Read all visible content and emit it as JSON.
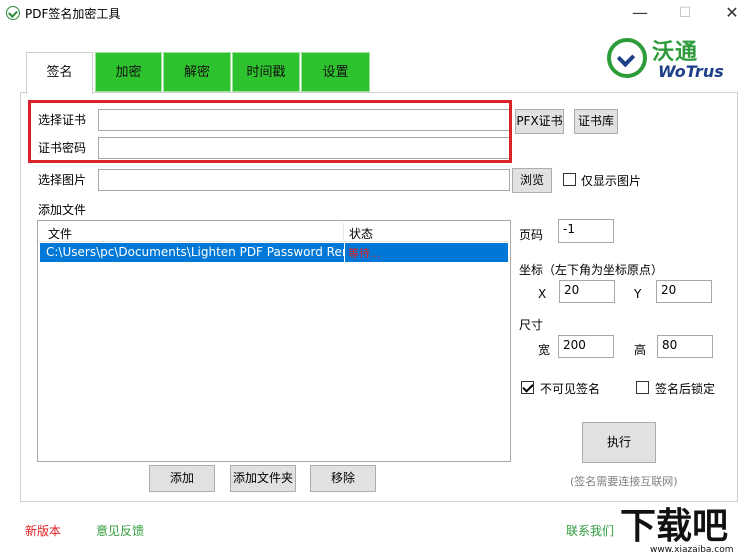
{
  "window": {
    "title": "PDF签名加密工具",
    "minimize": "—",
    "maximize": "☐",
    "close": "✕"
  },
  "logo": {
    "cn": "沃通",
    "en": "WoTrus"
  },
  "tabs": [
    {
      "label": "签名",
      "active": true
    },
    {
      "label": "加密",
      "active": false
    },
    {
      "label": "解密",
      "active": false
    },
    {
      "label": "时间戳",
      "active": false
    },
    {
      "label": "设置",
      "active": false
    }
  ],
  "form": {
    "cert_label": "选择证书",
    "cert_value": "",
    "password_label": "证书密码",
    "password_value": "",
    "pfx_button": "PFX证书",
    "certstore_button": "证书库",
    "image_label": "选择图片",
    "image_value": "",
    "browse_button": "浏览",
    "only_image_label": "仅显示图片",
    "only_image_checked": false
  },
  "files": {
    "section_label": "添加文件",
    "columns": [
      "文件",
      "状态"
    ],
    "rows": [
      {
        "file": "C:\\Users\\pc\\Documents\\Lighten PDF Password Ren",
        "status": "等待..."
      }
    ],
    "add_button": "添加",
    "add_folder_button": "添加文件夹",
    "remove_button": "移除"
  },
  "settings": {
    "page_label": "页码",
    "page_value": "-1",
    "coord_label": "坐标（左下角为坐标原点）",
    "x_label": "X",
    "x_value": "20",
    "y_label": "Y",
    "y_value": "20",
    "size_label": "尺寸",
    "width_label": "宽",
    "width_value": "200",
    "height_label": "高",
    "height_value": "80",
    "invisible_label": "不可见签名",
    "invisible_checked": true,
    "lock_label": "签名后锁定",
    "lock_checked": false,
    "execute_button": "执行",
    "network_note": "(签名需要连接互联网)"
  },
  "footer": {
    "new_version": "新版本",
    "feedback": "意见反馈",
    "contact": "联系我们"
  },
  "watermark": {
    "big": "下载吧",
    "small": "www.xiazaiba.com"
  },
  "colors": {
    "tab_green": "#2fc22f",
    "selection_blue": "#0078d7",
    "highlight_red": "#d9232b",
    "status_red": "#e02020",
    "link_green": "#2e9c3a"
  }
}
